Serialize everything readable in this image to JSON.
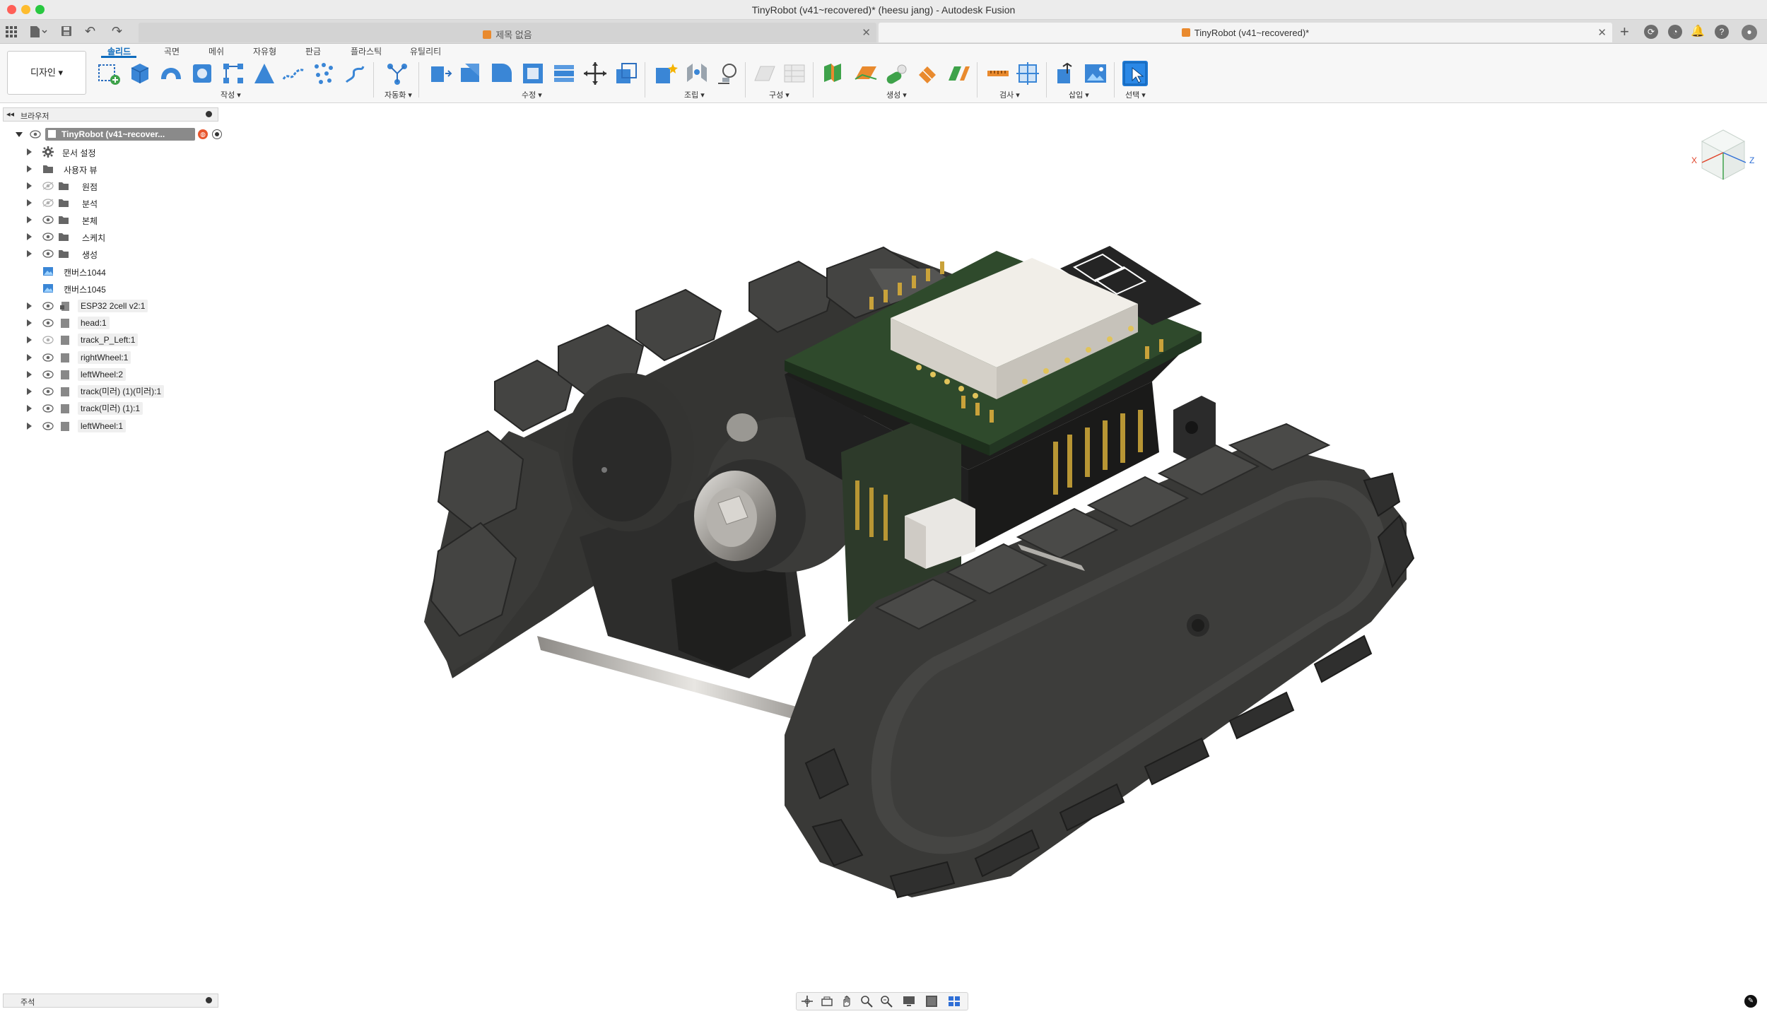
{
  "window": {
    "title": "TinyRobot (v41~recovered)* (heesu jang) - Autodesk Fusion"
  },
  "tabs": [
    {
      "label": "제목 없음",
      "active": false
    },
    {
      "label": "TinyRobot (v41~recovered)*",
      "active": true
    }
  ],
  "toolbar": {
    "workspace": "디자인",
    "ribbon_tabs": [
      "솔리드",
      "곡면",
      "메쉬",
      "자유형",
      "판금",
      "플라스틱",
      "유틸리티"
    ],
    "groups": [
      "작성 ▾",
      "자동화 ▾",
      "수정 ▾",
      "조립 ▾",
      "구성 ▾",
      "생성 ▾",
      "검사 ▾",
      "삽입 ▾",
      "선택 ▾"
    ]
  },
  "browser": {
    "title": "브라우저",
    "root": "TinyRobot (v41~recover...",
    "items": [
      "문서 설정",
      "사용자 뷰",
      "원점",
      "분석",
      "본체",
      "스케치",
      "생성",
      "캔버스1044",
      "캔버스1045",
      "ESP32 2cell v2:1",
      "head:1",
      "track_P_Left:1",
      "rightWheel:1",
      "leftWheel:2",
      "track(미러) (1)(미러):1",
      "track(미러) (1):1",
      "leftWheel:1"
    ]
  },
  "viewcube": {
    "x_label": "X",
    "z_label": "Z"
  },
  "comments": {
    "title": "주석"
  },
  "colors": {
    "accent": "#0f6cbd",
    "tool_blue": "#3a86d6",
    "tool_green": "#3ea24a",
    "tool_orange": "#e98a2e"
  }
}
